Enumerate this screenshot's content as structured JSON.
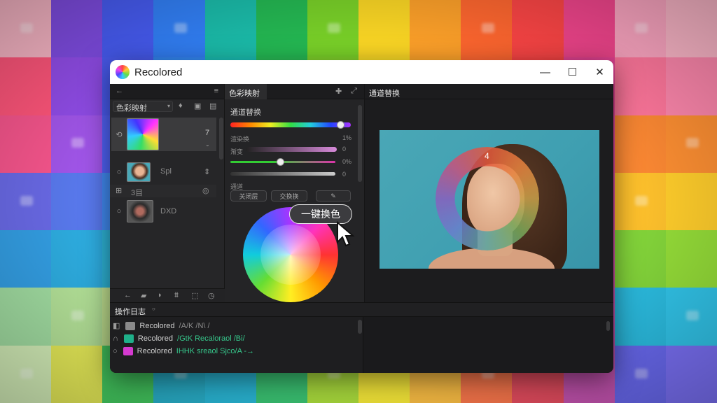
{
  "app": {
    "title": "Recolored",
    "controls": {
      "minimize": "—",
      "maximize": "☐",
      "close": "✕"
    }
  },
  "left_panel": {
    "back_icon": "←",
    "menu_icon": "≡",
    "mode_label": "色彩映射",
    "layers": [
      {
        "label": "7"
      },
      {
        "label": "Spl"
      },
      {
        "label": "DXD"
      }
    ],
    "group_label": "3目"
  },
  "middle_panel": {
    "tab_label": "色彩映射",
    "section_title": "通道替换",
    "row_label_1": "渲染换",
    "row_value_1": "1%",
    "row_label_2": "渐变",
    "row_value_2": "0",
    "row_value_3": "0%",
    "row_value_4": "0",
    "section2_title": "通道",
    "chips": [
      "关闭层",
      "交换换",
      "✎"
    ],
    "cta_label": "一键换色"
  },
  "right_panel": {
    "tab_label": "通道替换",
    "ring_label": "4"
  },
  "log": {
    "title": "操作日志",
    "entries": [
      {
        "app": "Recolored",
        "text": "/A/K /N\\ /"
      },
      {
        "app": "Recolored",
        "text": "/GtK Recaloraol /Bi/"
      },
      {
        "app": "Recolored",
        "text": "IHHK sreaol Sjco/A -→"
      }
    ],
    "colors": [
      "#8a8a8a",
      "#1fb08a",
      "#d53ad0"
    ]
  }
}
